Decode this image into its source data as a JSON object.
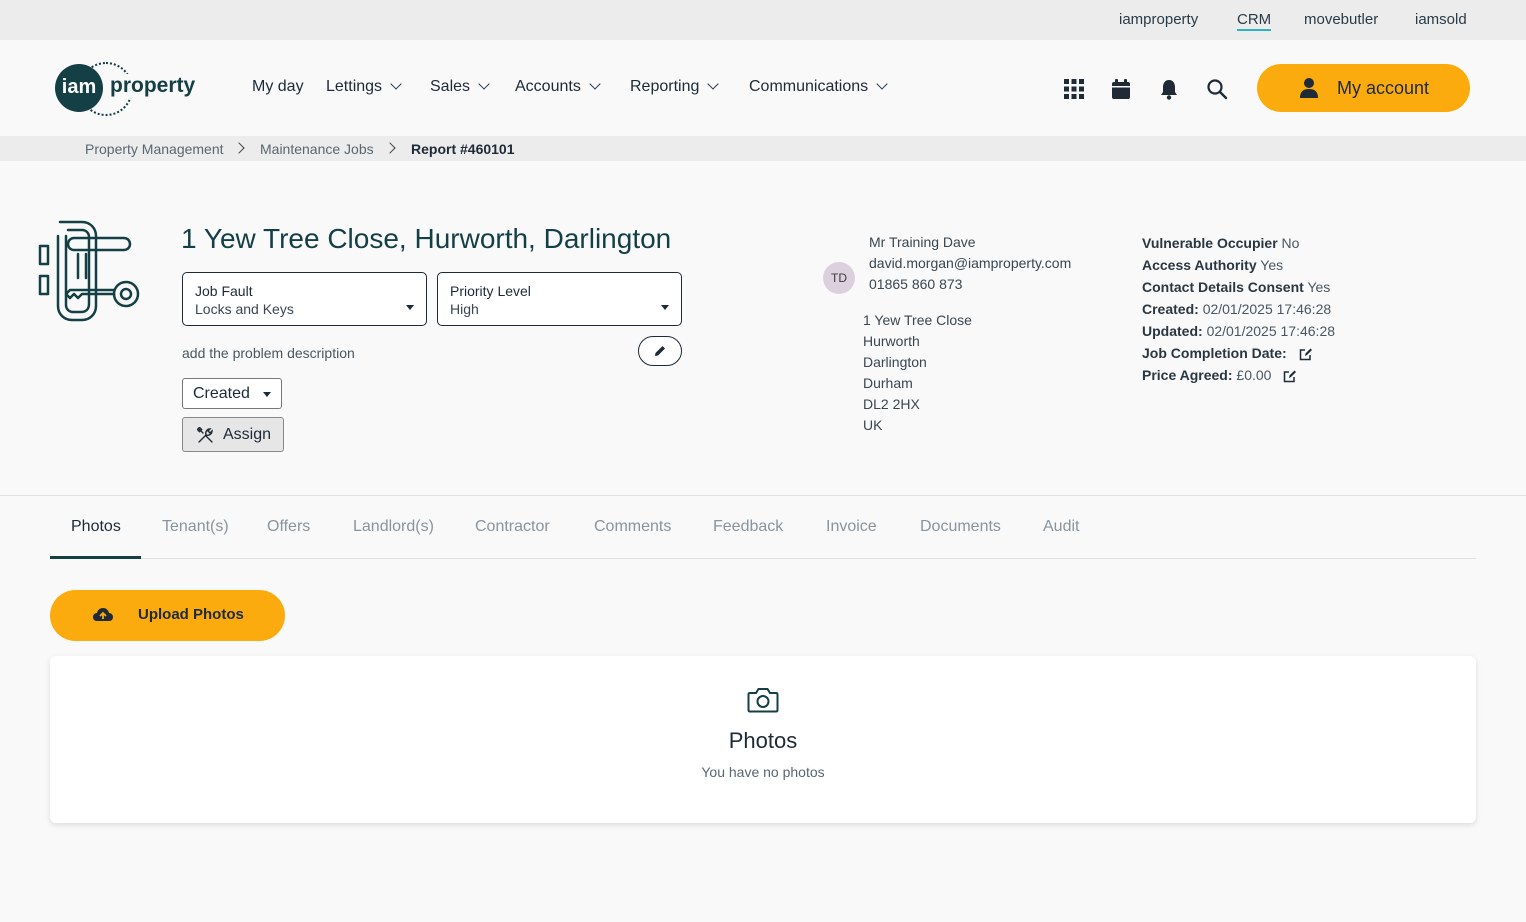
{
  "top_links": [
    "iamproperty",
    "CRM",
    "movebutler",
    "iamsold"
  ],
  "logo": {
    "mark": "iam",
    "word": "property"
  },
  "nav": [
    "My day",
    "Lettings",
    "Sales",
    "Accounts",
    "Reporting",
    "Communications"
  ],
  "account_button": "My account",
  "breadcrumb": [
    "Property Management",
    "Maintenance Jobs",
    "Report #460101"
  ],
  "property": {
    "title": "1 Yew Tree Close, Hurworth, Darlington",
    "job_fault": {
      "label": "Job Fault",
      "value": "Locks and Keys"
    },
    "priority": {
      "label": "Priority Level",
      "value": "High"
    },
    "description_placeholder": "add the problem description",
    "status": "Created",
    "assign_label": "Assign"
  },
  "contact": {
    "initials": "TD",
    "name": "Mr Training Dave",
    "email": "david.morgan@iamproperty.com",
    "phone": "01865 860 873",
    "address": [
      "1 Yew Tree Close",
      "Hurworth",
      "Darlington",
      "Durham",
      "DL2 2HX",
      "UK"
    ]
  },
  "details": [
    {
      "label": "Vulnerable Occupier",
      "value": "No"
    },
    {
      "label": "Access Authority",
      "value": "Yes"
    },
    {
      "label": "Contact Details Consent",
      "value": "Yes"
    },
    {
      "label": "Created:",
      "value": "02/01/2025 17:46:28"
    },
    {
      "label": "Updated:",
      "value": "02/01/2025 17:46:28"
    },
    {
      "label": "Job Completion Date:",
      "value": ""
    },
    {
      "label": "Price Agreed:",
      "value": "£0.00"
    }
  ],
  "tabs": [
    "Photos",
    "Tenant(s)",
    "Offers",
    "Landlord(s)",
    "Contractor",
    "Comments",
    "Feedback",
    "Invoice",
    "Documents",
    "Audit"
  ],
  "upload_button": "Upload Photos",
  "photos_panel": {
    "title": "Photos",
    "empty_text": "You have no photos"
  },
  "colors": {
    "accent": "#fcab0e",
    "brand": "#133f45",
    "link_underline": "#2bb3c0"
  }
}
